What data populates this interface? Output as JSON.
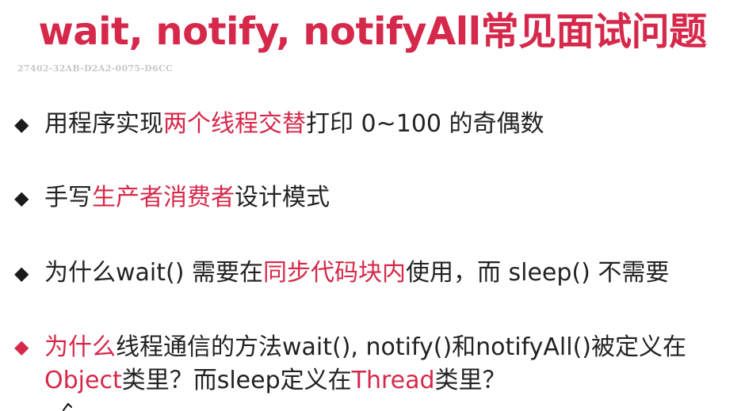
{
  "title": "wait, notify, notifyAll常见面试问题",
  "watermark": "27402-32AB-D2A2-0075-D6CC",
  "bullets": [
    {
      "marker": "◆",
      "t1": "用程序实现",
      "t2": "两个线程交替",
      "t3": "打印 0~100 的奇偶数"
    },
    {
      "marker": "◆",
      "t1": "手写",
      "t2": "生产者消费者",
      "t3": "设计模式"
    },
    {
      "marker": "◆",
      "t1": "为什么wait() 需要在",
      "t2": "同步代码块内",
      "t3": "使用，而 sleep() 不需要"
    },
    {
      "marker": "◆",
      "t1": "为什么",
      "t2": "线程通信的方法wait(), notify()和notifyAll()被定义在",
      "t3": "Object",
      "t4": "类里？而sleep定义在",
      "t5": "Thread",
      "t6": "类里？"
    }
  ],
  "colors": {
    "accent": "#d6284a",
    "text": "#222222",
    "watermark": "#c8c8c8"
  }
}
